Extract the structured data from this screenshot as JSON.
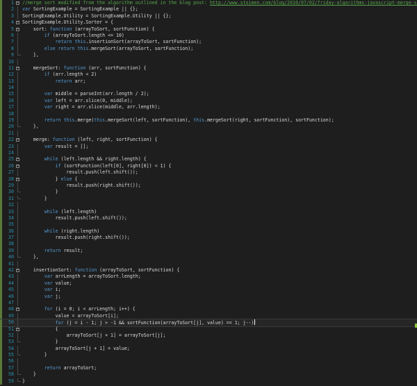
{
  "editor": {
    "lines": [
      {
        "n": "1",
        "fold": true,
        "seg": [
          {
            "t": "//merge sort modified from the algorithm outlined in the blog post: ",
            "c": "cm"
          },
          {
            "t": "http://www.stoimen.com/blog/2010/07/02/friday-algorithms-javascript-merge-so",
            "c": "url"
          }
        ]
      },
      {
        "n": "2",
        "seg": [
          {
            "t": "var",
            "c": "kw"
          },
          {
            "t": " SortingExample = SortingExample || {};",
            "c": "tx"
          }
        ]
      },
      {
        "n": "3",
        "seg": [
          {
            "t": "SortingExample.Utility = SortingExample.Utility || {};",
            "c": "tx"
          }
        ]
      },
      {
        "n": "4",
        "fold": true,
        "seg": [
          {
            "t": "SortingExample.Utility.Sorter = {",
            "c": "tx"
          }
        ]
      },
      {
        "n": "5",
        "fold": true,
        "seg": [
          {
            "t": "    sort: ",
            "c": "tx"
          },
          {
            "t": "function",
            "c": "kw"
          },
          {
            "t": " (arrayToSort, sortFunction) {",
            "c": "tx"
          }
        ]
      },
      {
        "n": "6",
        "seg": [
          {
            "t": "        ",
            "c": "tx"
          },
          {
            "t": "if",
            "c": "kw"
          },
          {
            "t": " (arrayToSort.length <= 10)",
            "c": "tx"
          }
        ]
      },
      {
        "n": "7",
        "seg": [
          {
            "t": "            ",
            "c": "tx"
          },
          {
            "t": "return",
            "c": "kw"
          },
          {
            "t": " ",
            "c": "tx"
          },
          {
            "t": "this",
            "c": "kw"
          },
          {
            "t": ".insertionSort(arrayToSort, sortFunction);",
            "c": "tx"
          }
        ]
      },
      {
        "n": "8",
        "seg": [
          {
            "t": "        ",
            "c": "tx"
          },
          {
            "t": "else return",
            "c": "kw"
          },
          {
            "t": " ",
            "c": "tx"
          },
          {
            "t": "this",
            "c": "kw"
          },
          {
            "t": ".mergeSort(arrayToSort, sortFunction);",
            "c": "tx"
          }
        ]
      },
      {
        "n": "9",
        "end": true,
        "seg": [
          {
            "t": "    },",
            "c": "tx"
          }
        ]
      },
      {
        "n": "10",
        "seg": []
      },
      {
        "n": "11",
        "fold": true,
        "seg": [
          {
            "t": "    mergeSort: ",
            "c": "tx"
          },
          {
            "t": "function",
            "c": "kw"
          },
          {
            "t": " (arr, sortFunction) {",
            "c": "tx"
          }
        ]
      },
      {
        "n": "12",
        "seg": [
          {
            "t": "        ",
            "c": "tx"
          },
          {
            "t": "if",
            "c": "kw"
          },
          {
            "t": " (arr.length < 2)",
            "c": "tx"
          }
        ]
      },
      {
        "n": "13",
        "seg": [
          {
            "t": "            ",
            "c": "tx"
          },
          {
            "t": "return",
            "c": "kw"
          },
          {
            "t": " arr;",
            "c": "tx"
          }
        ]
      },
      {
        "n": "14",
        "seg": []
      },
      {
        "n": "15",
        "seg": [
          {
            "t": "        ",
            "c": "tx"
          },
          {
            "t": "var",
            "c": "kw"
          },
          {
            "t": " middle = parseInt(arr.length / 2);",
            "c": "tx"
          }
        ]
      },
      {
        "n": "16",
        "seg": [
          {
            "t": "        ",
            "c": "tx"
          },
          {
            "t": "var",
            "c": "kw"
          },
          {
            "t": " left = arr.slice(0, middle);",
            "c": "tx"
          }
        ]
      },
      {
        "n": "17",
        "seg": [
          {
            "t": "        ",
            "c": "tx"
          },
          {
            "t": "var",
            "c": "kw"
          },
          {
            "t": " right = arr.slice(middle, arr.length);",
            "c": "tx"
          }
        ]
      },
      {
        "n": "18",
        "seg": []
      },
      {
        "n": "19",
        "seg": [
          {
            "t": "        ",
            "c": "tx"
          },
          {
            "t": "return",
            "c": "kw"
          },
          {
            "t": " ",
            "c": "tx"
          },
          {
            "t": "this",
            "c": "kw"
          },
          {
            "t": ".merge(",
            "c": "tx"
          },
          {
            "t": "this",
            "c": "kw"
          },
          {
            "t": ".mergeSort(left, sortFunction), ",
            "c": "tx"
          },
          {
            "t": "this",
            "c": "kw"
          },
          {
            "t": ".mergeSort(right, sortFunction), sortFunction);",
            "c": "tx"
          }
        ]
      },
      {
        "n": "20",
        "end": true,
        "seg": [
          {
            "t": "    },",
            "c": "tx"
          }
        ]
      },
      {
        "n": "21",
        "seg": []
      },
      {
        "n": "22",
        "fold": true,
        "seg": [
          {
            "t": "    merge: ",
            "c": "tx"
          },
          {
            "t": "function",
            "c": "kw"
          },
          {
            "t": " (left, right, sortFunction) {",
            "c": "tx"
          }
        ]
      },
      {
        "n": "23",
        "seg": [
          {
            "t": "        ",
            "c": "tx"
          },
          {
            "t": "var",
            "c": "kw"
          },
          {
            "t": " result = [];",
            "c": "tx"
          }
        ]
      },
      {
        "n": "24",
        "seg": []
      },
      {
        "n": "25",
        "fold": true,
        "seg": [
          {
            "t": "        ",
            "c": "tx"
          },
          {
            "t": "while",
            "c": "kw"
          },
          {
            "t": " (left.length && right.length) {",
            "c": "tx"
          }
        ]
      },
      {
        "n": "26",
        "fold": true,
        "seg": [
          {
            "t": "            ",
            "c": "tx"
          },
          {
            "t": "if",
            "c": "kw"
          },
          {
            "t": " (sortFunction(left[0], right[0]) < 1) {",
            "c": "tx"
          }
        ]
      },
      {
        "n": "27",
        "seg": [
          {
            "t": "                result.push(left.shift());",
            "c": "tx"
          }
        ]
      },
      {
        "n": "28",
        "fold": true,
        "seg": [
          {
            "t": "            } ",
            "c": "tx"
          },
          {
            "t": "else",
            "c": "kw"
          },
          {
            "t": " {",
            "c": "tx"
          }
        ]
      },
      {
        "n": "29",
        "seg": [
          {
            "t": "                result.push(right.shift());",
            "c": "tx"
          }
        ]
      },
      {
        "n": "30",
        "end": true,
        "seg": [
          {
            "t": "            }",
            "c": "tx"
          }
        ]
      },
      {
        "n": "31",
        "end": true,
        "seg": [
          {
            "t": "        }",
            "c": "tx"
          }
        ]
      },
      {
        "n": "32",
        "seg": []
      },
      {
        "n": "33",
        "seg": [
          {
            "t": "        ",
            "c": "tx"
          },
          {
            "t": "while",
            "c": "kw"
          },
          {
            "t": " (left.length)",
            "c": "tx"
          }
        ]
      },
      {
        "n": "34",
        "seg": [
          {
            "t": "            result.push(left.shift());",
            "c": "tx"
          }
        ]
      },
      {
        "n": "35",
        "seg": []
      },
      {
        "n": "36",
        "seg": [
          {
            "t": "        ",
            "c": "tx"
          },
          {
            "t": "while",
            "c": "kw"
          },
          {
            "t": " (right.length)",
            "c": "tx"
          }
        ]
      },
      {
        "n": "37",
        "seg": [
          {
            "t": "            result.push(right.shift());",
            "c": "tx"
          }
        ]
      },
      {
        "n": "38",
        "seg": []
      },
      {
        "n": "39",
        "seg": [
          {
            "t": "        ",
            "c": "tx"
          },
          {
            "t": "return",
            "c": "kw"
          },
          {
            "t": " result;",
            "c": "tx"
          }
        ]
      },
      {
        "n": "40",
        "end": true,
        "seg": [
          {
            "t": "    },",
            "c": "tx"
          }
        ]
      },
      {
        "n": "41",
        "seg": []
      },
      {
        "n": "42",
        "fold": true,
        "seg": [
          {
            "t": "    insertionSort: ",
            "c": "tx"
          },
          {
            "t": "function",
            "c": "kw"
          },
          {
            "t": " (arrayToSort, sortFunction) {",
            "c": "tx"
          }
        ]
      },
      {
        "n": "43",
        "seg": [
          {
            "t": "        ",
            "c": "tx"
          },
          {
            "t": "var",
            "c": "kw"
          },
          {
            "t": " arrLength = arrayToSort.length;",
            "c": "tx"
          }
        ]
      },
      {
        "n": "44",
        "seg": [
          {
            "t": "        ",
            "c": "tx"
          },
          {
            "t": "var",
            "c": "kw"
          },
          {
            "t": " value;",
            "c": "tx"
          }
        ]
      },
      {
        "n": "45",
        "seg": [
          {
            "t": "        ",
            "c": "tx"
          },
          {
            "t": "var",
            "c": "kw"
          },
          {
            "t": " i;",
            "c": "tx"
          }
        ]
      },
      {
        "n": "46",
        "seg": [
          {
            "t": "        ",
            "c": "tx"
          },
          {
            "t": "var",
            "c": "kw"
          },
          {
            "t": " j;",
            "c": "tx"
          }
        ]
      },
      {
        "n": "47",
        "seg": []
      },
      {
        "n": "48",
        "fold": true,
        "seg": [
          {
            "t": "        ",
            "c": "tx"
          },
          {
            "t": "for",
            "c": "kw"
          },
          {
            "t": " (i = 0; i < arrLength; i++) {",
            "c": "tx"
          }
        ]
      },
      {
        "n": "49",
        "seg": [
          {
            "t": "            value = arrayToSort[i];",
            "c": "tx"
          }
        ]
      },
      {
        "n": "50",
        "current": true,
        "caret": true,
        "seg": [
          {
            "t": "            ",
            "c": "tx"
          },
          {
            "t": "for",
            "c": "kw"
          },
          {
            "t": " (j = i - 1; j > -1 && sortFunction(arrayToSort[j], value) == 1; j--)",
            "c": "tx"
          }
        ]
      },
      {
        "n": "51",
        "fold": true,
        "seg": [
          {
            "t": "            {",
            "c": "tx"
          }
        ]
      },
      {
        "n": "52",
        "seg": [
          {
            "t": "                arrayToSort[j + 1] = arrayToSort[j];",
            "c": "tx"
          }
        ]
      },
      {
        "n": "53",
        "end": true,
        "seg": [
          {
            "t": "            }",
            "c": "tx"
          }
        ]
      },
      {
        "n": "54",
        "seg": [
          {
            "t": "            arrayToSort[j + 1] = value;",
            "c": "tx"
          }
        ]
      },
      {
        "n": "55",
        "end": true,
        "seg": [
          {
            "t": "        }",
            "c": "tx"
          }
        ]
      },
      {
        "n": "56",
        "seg": []
      },
      {
        "n": "57",
        "seg": [
          {
            "t": "        ",
            "c": "tx"
          },
          {
            "t": "return",
            "c": "kw"
          },
          {
            "t": " arrayToSort;",
            "c": "tx"
          }
        ]
      },
      {
        "n": "58",
        "end": true,
        "seg": [
          {
            "t": "    }",
            "c": "tx"
          }
        ]
      },
      {
        "n": "59",
        "end": true,
        "seg": [
          {
            "t": "}",
            "c": "tx"
          }
        ]
      }
    ]
  }
}
